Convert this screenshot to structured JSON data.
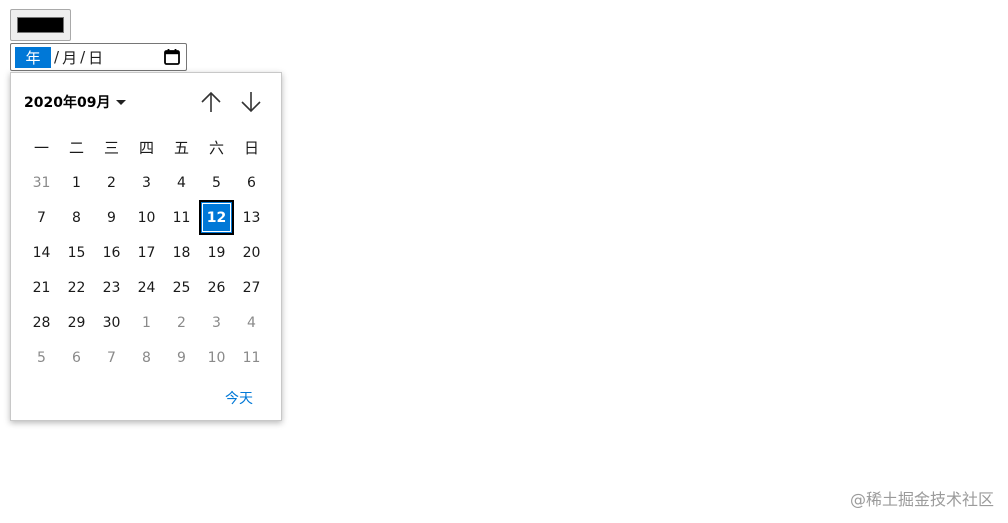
{
  "color_input": {
    "value": "#000000"
  },
  "date_input": {
    "year_placeholder": "年",
    "separator": "/",
    "month_placeholder": "月",
    "day_placeholder": "日",
    "calendar_icon": "calendar-icon"
  },
  "calendar": {
    "month_label": "2020年09月",
    "weekdays": [
      "一",
      "二",
      "三",
      "四",
      "五",
      "六",
      "日"
    ],
    "weeks": [
      [
        {
          "d": "31",
          "o": true
        },
        {
          "d": "1"
        },
        {
          "d": "2"
        },
        {
          "d": "3"
        },
        {
          "d": "4"
        },
        {
          "d": "5"
        },
        {
          "d": "6"
        }
      ],
      [
        {
          "d": "7"
        },
        {
          "d": "8"
        },
        {
          "d": "9"
        },
        {
          "d": "10"
        },
        {
          "d": "11"
        },
        {
          "d": "12",
          "s": true
        },
        {
          "d": "13"
        }
      ],
      [
        {
          "d": "14"
        },
        {
          "d": "15"
        },
        {
          "d": "16"
        },
        {
          "d": "17"
        },
        {
          "d": "18"
        },
        {
          "d": "19"
        },
        {
          "d": "20"
        }
      ],
      [
        {
          "d": "21"
        },
        {
          "d": "22"
        },
        {
          "d": "23"
        },
        {
          "d": "24"
        },
        {
          "d": "25"
        },
        {
          "d": "26"
        },
        {
          "d": "27"
        }
      ],
      [
        {
          "d": "28"
        },
        {
          "d": "29"
        },
        {
          "d": "30"
        },
        {
          "d": "1",
          "o": true
        },
        {
          "d": "2",
          "o": true
        },
        {
          "d": "3",
          "o": true
        },
        {
          "d": "4",
          "o": true
        }
      ],
      [
        {
          "d": "5",
          "o": true
        },
        {
          "d": "6",
          "o": true
        },
        {
          "d": "7",
          "o": true
        },
        {
          "d": "8",
          "o": true
        },
        {
          "d": "9",
          "o": true
        },
        {
          "d": "10",
          "o": true
        },
        {
          "d": "11",
          "o": true
        }
      ]
    ],
    "today_label": "今天",
    "accent_color": "#0078d7"
  },
  "watermark": "@稀土掘金技术社区"
}
